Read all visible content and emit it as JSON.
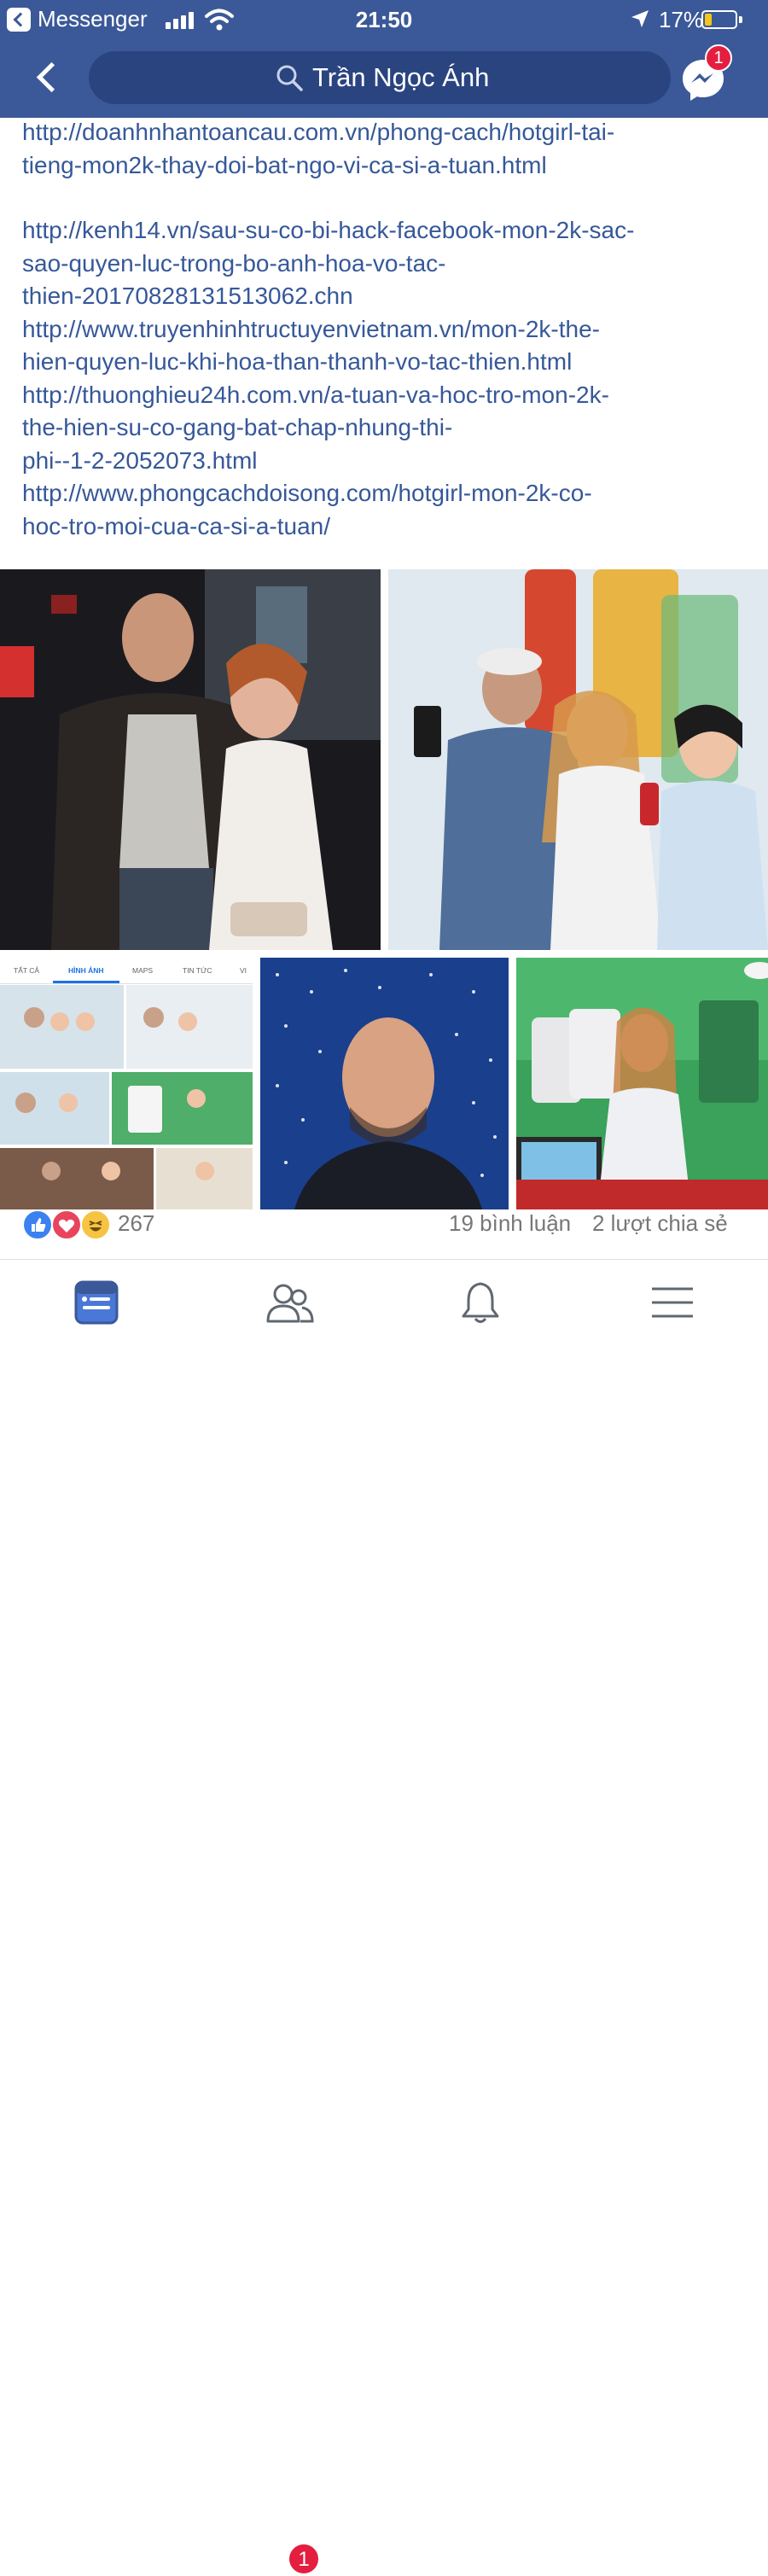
{
  "status_bar": {
    "app_name": "Messenger",
    "time": "21:50",
    "battery": "17%",
    "signal_bars": 4
  },
  "header": {
    "search_text": "Trần Ngọc Ánh",
    "messenger_badge": "1"
  },
  "post": {
    "links": [
      "http://doanhnhantoancau.com.vn/phong-cach/hotgirl-tai-tieng-mon2k-thay-doi-bat-ngo-vi-ca-si-a-tuan.html",
      "",
      "http://kenh14.vn/sau-su-co-bi-hack-facebook-mon-2k-sac-sao-quyen-luc-trong-bo-anh-hoa-vo-tac-thien-20170828131513062.chn",
      "http://www.truyenhinhtructuyenvietnam.vn/mon-2k-the-hien-quyen-luc-khi-hoa-than-thanh-vo-tac-thien.html",
      "http://thuonghieu24h.com.vn/a-tuan-va-hoc-tro-mon-2k-the-hien-su-co-gang-bat-chap-nhung-thi-phi--1-2-2052073.html",
      "http://www.phongcachdoisong.com/hotgirl-mon-2k-co-hoc-tro-moi-cua-ca-si-a-tuan/"
    ],
    "link_lines": [
      "http://doanhnhantoancau.com.vn/phong-cach/hotgirl-tai-",
      "tieng-mon2k-thay-doi-bat-ngo-vi-ca-si-a-tuan.html",
      "",
      "http://kenh14.vn/sau-su-co-bi-hack-facebook-mon-2k-sac-",
      "sao-quyen-luc-trong-bo-anh-hoa-vo-tac-",
      "thien-20170828131513062.chn",
      "http://www.truyenhinhtructuyenvietnam.vn/mon-2k-the-",
      "hien-quyen-luc-khi-hoa-than-thanh-vo-tac-thien.html",
      "http://thuonghieu24h.com.vn/a-tuan-va-hoc-tro-mon-2k-",
      "the-hien-su-co-gang-bat-chap-nhung-thi-",
      "phi--1-2-2052073.html",
      "http://www.phongcachdoisong.com/hotgirl-mon-2k-co-",
      "hoc-tro-moi-cua-ca-si-a-tuan/"
    ],
    "search_tabs": [
      "TẤT CẢ",
      "HÌNH ẢNH",
      "MAPS",
      "TIN TỨC",
      "VI"
    ],
    "reaction_count": "267",
    "comments": "19 bình luận",
    "shares": "2 lượt chia sẻ"
  },
  "tab_bar": {
    "friends_badge": "1"
  },
  "colors": {
    "brand_blue": "#3b5998",
    "link_blue": "#365899",
    "badge_red": "#e41e3f",
    "like_blue": "#3b82f0",
    "love_red": "#e9445d",
    "haha_yellow": "#f6c343"
  }
}
